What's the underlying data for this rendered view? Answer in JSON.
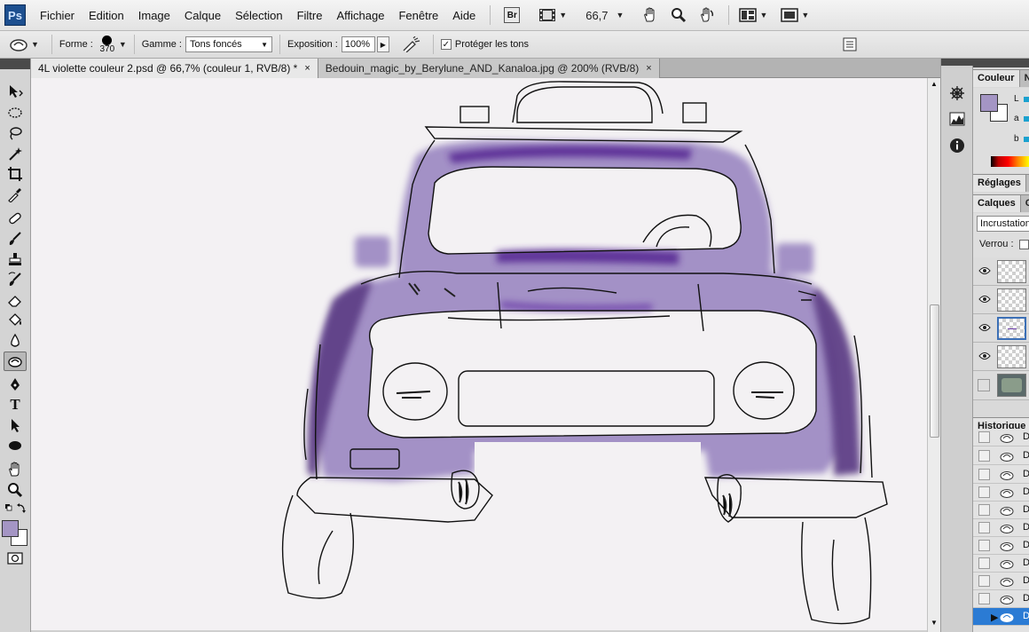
{
  "app": {
    "logo_text": "Ps",
    "menu": [
      "Fichier",
      "Edition",
      "Image",
      "Calque",
      "Sélection",
      "Filtre",
      "Affichage",
      "Fenêtre",
      "Aide"
    ],
    "bridge_label": "Br",
    "zoom": "66,7"
  },
  "options": {
    "forme_label": "Forme :",
    "brush_size": "370",
    "gamme_label": "Gamme :",
    "gamme_value": "Tons foncés",
    "exposition_label": "Exposition :",
    "exposition_value": "100%",
    "protect_label": "Protéger les tons",
    "protect_checked": true
  },
  "tabs": [
    {
      "label": "4L violette couleur 2.psd @ 66,7% (couleur 1, RVB/8) *",
      "close": "×",
      "active": true
    },
    {
      "label": "Bedouin_magic_by_Berylune_AND_Kanaloa.jpg @ 200% (RVB/8)",
      "close": "×",
      "active": false
    }
  ],
  "panels": {
    "couleur": {
      "tab": "Couleur",
      "tab2": "N",
      "l_label": "L",
      "a_label": "a",
      "b_label": "b",
      "foreground": "#a495c4",
      "background": "#ffffff"
    },
    "reglages": {
      "tab": "Réglages",
      "tab2": "S"
    },
    "calques": {
      "tab": "Calques",
      "tab2": "Co",
      "blend_mode": "Incrustation",
      "lock_label": "Verrou :",
      "layers": [
        {
          "visible": true,
          "thumb": "transparent",
          "selected": false
        },
        {
          "visible": true,
          "thumb": "transparent",
          "selected": false
        },
        {
          "visible": true,
          "thumb": "transparent",
          "selected": true
        },
        {
          "visible": true,
          "thumb": "transparent",
          "selected": false
        },
        {
          "visible": false,
          "thumb": "photo",
          "selected": false
        }
      ]
    },
    "historique": {
      "tab": "Historique",
      "rows": [
        "D",
        "D",
        "D",
        "D",
        "D",
        "D",
        "D",
        "D",
        "D",
        "D"
      ],
      "current_row": "D"
    }
  },
  "colors": {
    "car_purple": "#a391c6",
    "car_dark_purple": "#5e3f87",
    "roof_stripe": "#5c2f96",
    "selection_blue": "#2b7bd4"
  }
}
